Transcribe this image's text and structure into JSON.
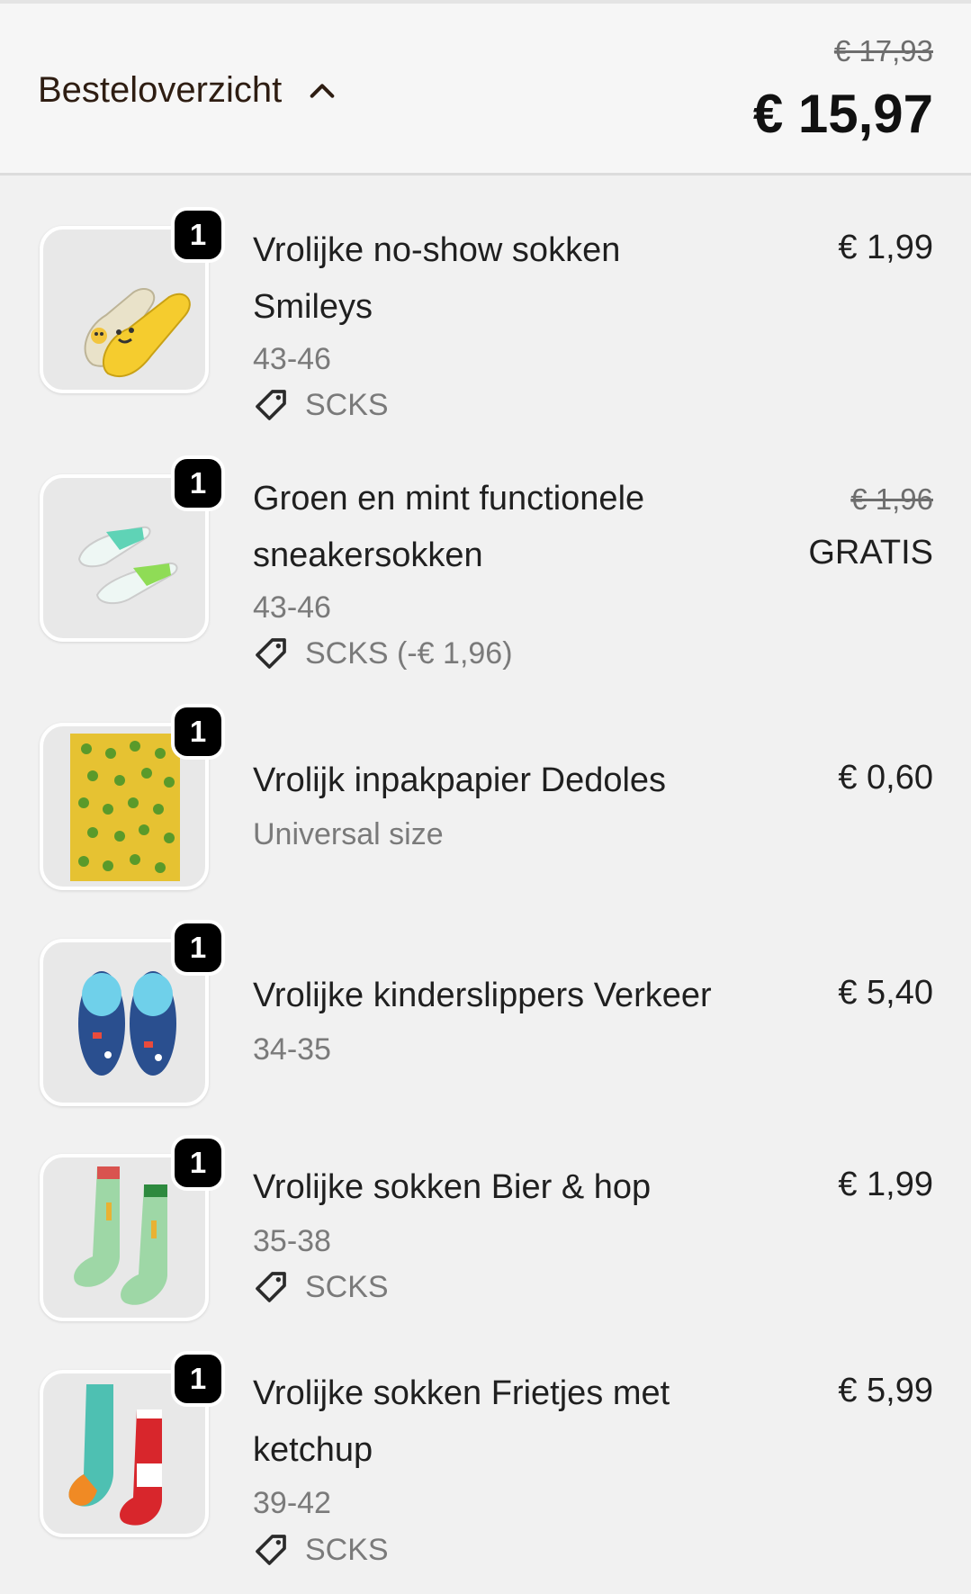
{
  "header": {
    "title": "Besteloverzicht",
    "total_original": "€ 17,93",
    "total": "€ 15,97"
  },
  "items": [
    {
      "quantity": "1",
      "name_line1": "Vrolijke no-show sokken",
      "name_line2": "Smileys",
      "size": "43-46",
      "coupon": "SCKS",
      "price": "€ 1,99"
    },
    {
      "quantity": "1",
      "name_line1": "Groen en mint functionele",
      "name_line2": "sneakersokken",
      "size": "43-46",
      "coupon": "SCKS (-€ 1,96)",
      "price_original": "€ 1,96",
      "price": "GRATIS"
    },
    {
      "quantity": "1",
      "name_line1": "Vrolijk inpakpapier Dedoles",
      "size": "Universal size",
      "price": "€ 0,60"
    },
    {
      "quantity": "1",
      "name_line1": "Vrolijke kinderslippers Verkeer",
      "size": "34-35",
      "price": "€ 5,40"
    },
    {
      "quantity": "1",
      "name_line1": "Vrolijke sokken Bier & hop",
      "size": "35-38",
      "coupon": "SCKS",
      "price": "€ 1,99"
    },
    {
      "quantity": "1",
      "name_line1": "Vrolijke sokken Frietjes met",
      "name_line2": "ketchup",
      "size": "39-42",
      "coupon": "SCKS",
      "price": "€ 5,99"
    }
  ],
  "icons": {
    "toggle": "chevron-up-icon",
    "coupon": "tag-icon"
  },
  "colors": {
    "background": "#f1f1f1",
    "header_background": "#f6f6f6",
    "text": "#1f1f1f",
    "muted": "#7a7a7a",
    "badge": "#000000"
  }
}
